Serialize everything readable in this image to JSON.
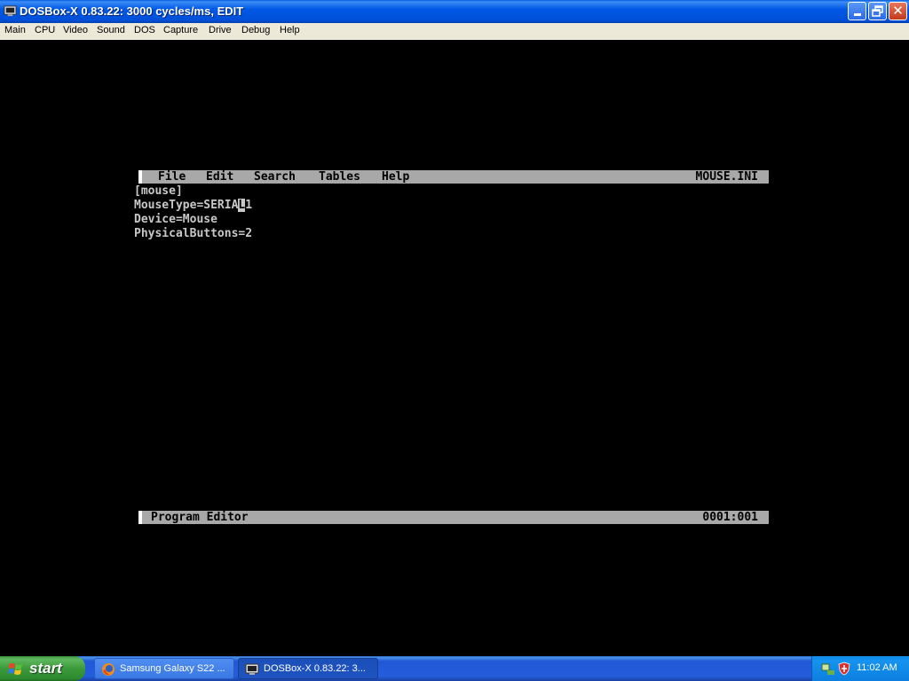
{
  "window": {
    "title": "DOSBox-X 0.83.22: 3000 cycles/ms, EDIT"
  },
  "menubar": {
    "items": [
      "Main",
      "CPU",
      "Video",
      "Sound",
      "DOS",
      "Capture",
      "Drive",
      "Debug",
      "Help"
    ]
  },
  "editor": {
    "menu": [
      "File",
      "Edit",
      "Search",
      "Tables",
      "Help"
    ],
    "filename": "MOUSE.INI",
    "lines": [
      {
        "before": "[mouse]",
        "cursor": "",
        "after": ""
      },
      {
        "before": "MouseType=SERIA",
        "cursor": "L",
        "after": "1"
      },
      {
        "before": "Device=Mouse",
        "cursor": "",
        "after": ""
      },
      {
        "before": "PhysicalButtons=2",
        "cursor": "",
        "after": ""
      }
    ],
    "status_label": "Program Editor",
    "position": "0001:001"
  },
  "taskbar": {
    "start_label": "start",
    "tasks": [
      {
        "label": "Samsung Galaxy S22 ...",
        "icon": "firefox-icon",
        "active": false
      },
      {
        "label": "DOSBox-X 0.83.22: 3...",
        "icon": "dosbox-icon",
        "active": true
      }
    ],
    "clock": "11:02 AM"
  },
  "colors": {
    "titlebar_blue": "#0058e6",
    "dos_bar_gray": "#a8a8a8",
    "dos_text": "#c8c8c8",
    "start_green": "#3a9a3a"
  }
}
